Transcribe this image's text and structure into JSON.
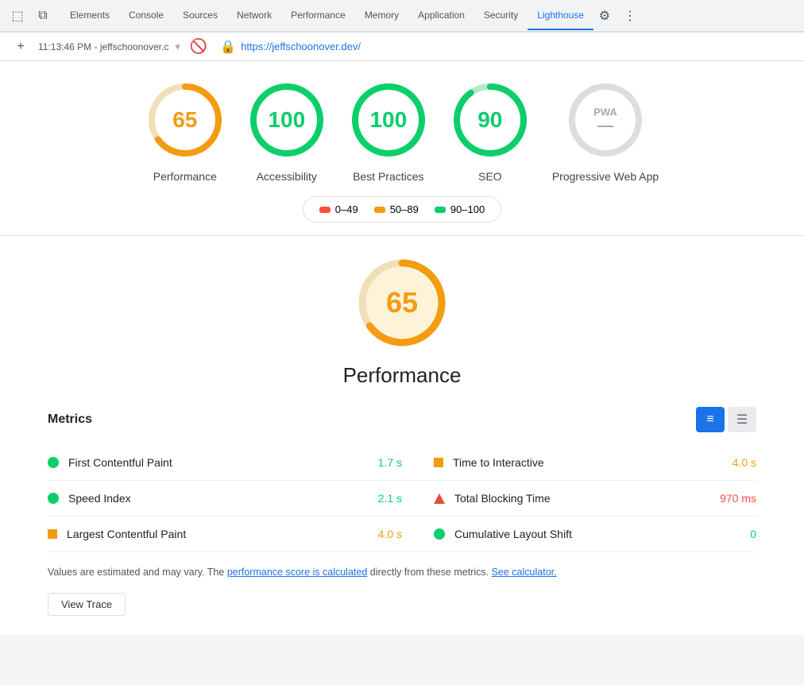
{
  "devtools": {
    "tabs": [
      "Elements",
      "Console",
      "Sources",
      "Network",
      "Performance",
      "Memory",
      "Application",
      "Security",
      "Lighthouse"
    ],
    "active_tab": "Lighthouse",
    "timestamp": "11:13:46 PM - jeffschoonover.c",
    "url": "https://jeffschoonover.dev/"
  },
  "scores": [
    {
      "id": "performance",
      "value": 65,
      "label": "Performance",
      "color": "#f39c12",
      "bg_color": "#fef3d9",
      "track_color": "#f0e0b8"
    },
    {
      "id": "accessibility",
      "value": 100,
      "label": "Accessibility",
      "color": "#0cce6b",
      "bg_color": "#e0f8ec",
      "track_color": "#b7e8cc"
    },
    {
      "id": "best-practices",
      "value": 100,
      "label": "Best Practices",
      "color": "#0cce6b",
      "bg_color": "#e0f8ec",
      "track_color": "#b7e8cc"
    },
    {
      "id": "seo",
      "value": 90,
      "label": "SEO",
      "color": "#0cce6b",
      "bg_color": "#e0f8ec",
      "track_color": "#b7e8cc"
    },
    {
      "id": "pwa",
      "value": null,
      "label": "Progressive Web App",
      "color": "#999",
      "bg_color": "#eee",
      "track_color": "#ddd"
    }
  ],
  "legend": [
    {
      "label": "0–49",
      "color": "#ff4e42"
    },
    {
      "label": "50–89",
      "color": "#f39c12"
    },
    {
      "label": "90–100",
      "color": "#0cce6b"
    }
  ],
  "performance_detail": {
    "score": 65,
    "title": "Performance",
    "metrics_label": "Metrics"
  },
  "metrics": [
    {
      "name": "First Contentful Paint",
      "value": "1.7 s",
      "value_color": "green",
      "indicator": "dot-green"
    },
    {
      "name": "Speed Index",
      "value": "2.1 s",
      "value_color": "green",
      "indicator": "dot-green"
    },
    {
      "name": "Largest Contentful Paint",
      "value": "4.0 s",
      "value_color": "orange",
      "indicator": "dot-orange"
    },
    {
      "name": "Time to Interactive",
      "value": "4.0 s",
      "value_color": "orange",
      "indicator": "square-orange"
    },
    {
      "name": "Total Blocking Time",
      "value": "970 ms",
      "value_color": "red",
      "indicator": "triangle-red"
    },
    {
      "name": "Cumulative Layout Shift",
      "value": "0",
      "value_color": "green",
      "indicator": "dot-green"
    }
  ],
  "footnote": {
    "text1": "Values are estimated and may vary. The ",
    "link1": "performance score is calculated",
    "text2": " directly from these metrics. ",
    "link2": "See calculator.",
    "view_trace": "View Trace"
  }
}
